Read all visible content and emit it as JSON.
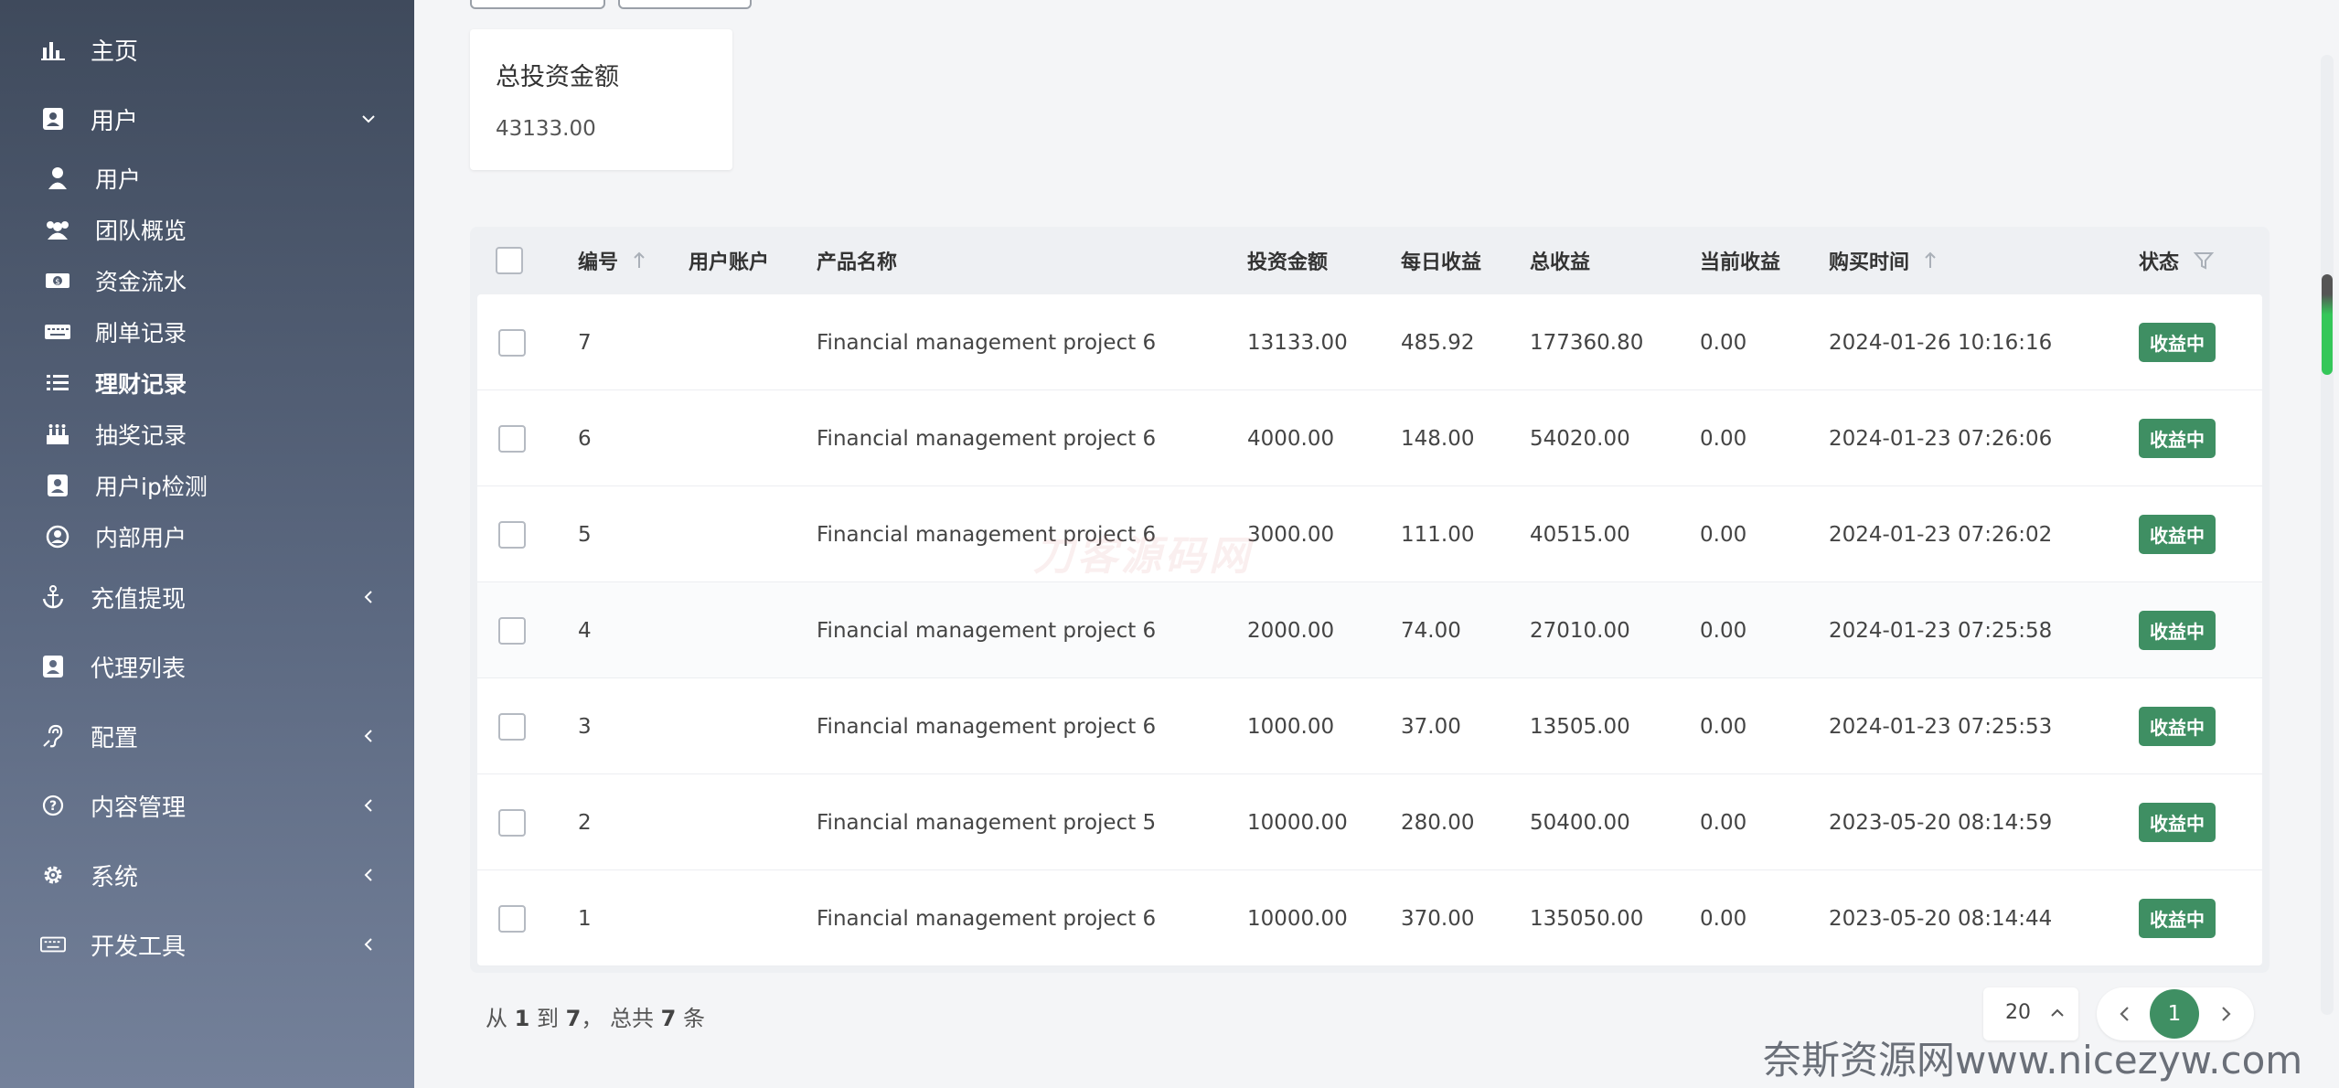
{
  "sidebar": {
    "items": [
      {
        "label": "主页",
        "icon": "bar-chart-icon"
      },
      {
        "label": "用户",
        "icon": "user-card-icon",
        "expanded": true
      },
      {
        "label": "充值提现",
        "icon": "anchor-icon"
      },
      {
        "label": "代理列表",
        "icon": "user-card-icon"
      },
      {
        "label": "配置",
        "icon": "hearing-icon"
      },
      {
        "label": "内容管理",
        "icon": "question-circle-icon"
      },
      {
        "label": "系统",
        "icon": "gear-icon"
      },
      {
        "label": "开发工具",
        "icon": "keyboard-icon"
      }
    ],
    "sub_items": [
      {
        "label": "用户",
        "icon": "user-icon"
      },
      {
        "label": "团队概览",
        "icon": "users-icon"
      },
      {
        "label": "资金流水",
        "icon": "money-icon"
      },
      {
        "label": "刷单记录",
        "icon": "keyboard-icon"
      },
      {
        "label": "理财记录",
        "icon": "list-icon",
        "active": true
      },
      {
        "label": "抽奖记录",
        "icon": "cake-icon"
      },
      {
        "label": "用户ip检测",
        "icon": "user-card-icon"
      },
      {
        "label": "内部用户",
        "icon": "user-circle-icon"
      }
    ]
  },
  "stat": {
    "title": "总投资金额",
    "value": "43133.00"
  },
  "table": {
    "columns": [
      "编号",
      "用户账户",
      "产品名称",
      "投资金额",
      "每日收益",
      "总收益",
      "当前收益",
      "购买时间",
      "状态"
    ],
    "rows": [
      {
        "id": "7",
        "account": "",
        "product": "Financial management project 6",
        "amount": "13133.00",
        "daily": "485.92",
        "total": "177360.80",
        "current": "0.00",
        "time": "2024-01-26 10:16:16",
        "status": "收益中"
      },
      {
        "id": "6",
        "account": "",
        "product": "Financial management project 6",
        "amount": "4000.00",
        "daily": "148.00",
        "total": "54020.00",
        "current": "0.00",
        "time": "2024-01-23 07:26:06",
        "status": "收益中"
      },
      {
        "id": "5",
        "account": "",
        "product": "Financial management project 6",
        "amount": "3000.00",
        "daily": "111.00",
        "total": "40515.00",
        "current": "0.00",
        "time": "2024-01-23 07:26:02",
        "status": "收益中"
      },
      {
        "id": "4",
        "account": "",
        "product": "Financial management project 6",
        "amount": "2000.00",
        "daily": "74.00",
        "total": "27010.00",
        "current": "0.00",
        "time": "2024-01-23 07:25:58",
        "status": "收益中"
      },
      {
        "id": "3",
        "account": "",
        "product": "Financial management project 6",
        "amount": "1000.00",
        "daily": "37.00",
        "total": "13505.00",
        "current": "0.00",
        "time": "2024-01-23 07:25:53",
        "status": "收益中"
      },
      {
        "id": "2",
        "account": "",
        "product": "Financial management project 5",
        "amount": "10000.00",
        "daily": "280.00",
        "total": "50400.00",
        "current": "0.00",
        "time": "2023-05-20 08:14:59",
        "status": "收益中"
      },
      {
        "id": "1",
        "account": "",
        "product": "Financial management project 6",
        "amount": "10000.00",
        "daily": "370.00",
        "total": "135050.00",
        "current": "0.00",
        "time": "2023-05-20 08:14:44",
        "status": "收益中"
      }
    ]
  },
  "footer": {
    "from_label": "从",
    "from": "1",
    "to_label": "到",
    "to": "7",
    "total_label": "， 总共",
    "total": "7",
    "unit": "条"
  },
  "pagination": {
    "per_page": "20",
    "current_page": "1"
  },
  "watermarks": {
    "center": "刀客源码网",
    "corner": "奈斯资源网www.nicezyw.com"
  },
  "colors": {
    "accent": "#3f8f63",
    "sidebar_top": "#3f4a5c",
    "sidebar_bottom": "#74819a"
  }
}
